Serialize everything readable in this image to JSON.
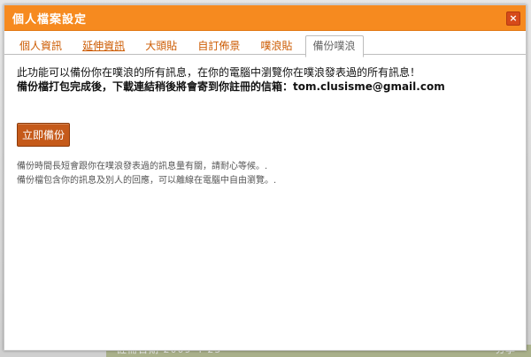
{
  "dialog": {
    "title": "個人檔案設定",
    "close_label": "×"
  },
  "tabs": [
    {
      "label": "個人資訊"
    },
    {
      "label": "延伸資訊"
    },
    {
      "label": "大頭貼"
    },
    {
      "label": "自訂佈景"
    },
    {
      "label": "噗浪貼"
    },
    {
      "label": "備份噗浪"
    }
  ],
  "content": {
    "intro_line1": "此功能可以備份你在噗浪的所有訊息，在你的電腦中瀏覽你在噗浪發表過的所有訊息！",
    "intro_line2_prefix": "備份檔打包完成後，下載連結稍後將會寄到你註冊的信箱：",
    "email": "tom.clusisme@gmail.com",
    "backup_button_label": "立即備份",
    "note1": "備份時間長短會跟你在噗浪發表過的訊息量有關，請耐心等候。.",
    "note2": "備份檔包含你的訊息及別人的回應，可以離線在電腦中自由瀏覽。."
  },
  "background": {
    "footer_text": "註冊日期 2009-4-25",
    "corner_text": "分享"
  },
  "colors": {
    "titlebar": "#f68a1f",
    "button": "#c55a1a",
    "tab_text": "#cc5a00"
  }
}
